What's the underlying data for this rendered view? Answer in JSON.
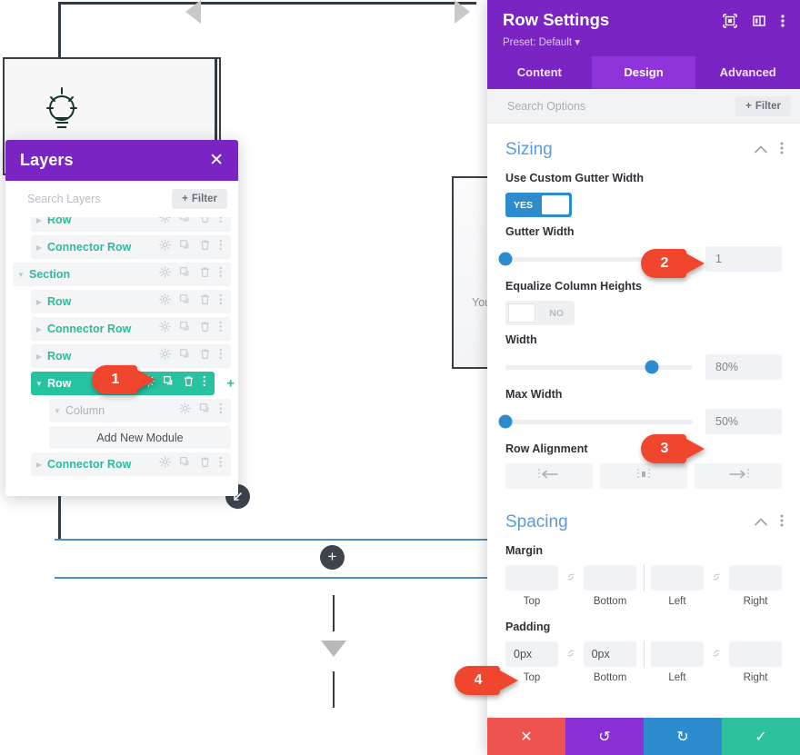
{
  "canvas": {
    "placeholder_text": "You",
    "add_section_icon": "plus-icon",
    "bulb_icon": "lightbulb-icon",
    "resize_icon": "resize-diagonal-icon"
  },
  "layers_panel": {
    "title": "Layers",
    "close_icon": "close-icon",
    "search_placeholder": "Search Layers",
    "filter_label": "Filter",
    "filter_icon": "plus-icon",
    "add_new_module": "Add New Module",
    "row_icons": [
      "gear-icon",
      "duplicate-icon",
      "trash-icon",
      "kebab-icon"
    ],
    "items": [
      {
        "label": "Row",
        "indent": 1,
        "selected": false,
        "clipped": true
      },
      {
        "label": "Connector Row",
        "indent": 1,
        "selected": false
      },
      {
        "label": "Section",
        "indent": 0,
        "selected": false
      },
      {
        "label": "Row",
        "indent": 1,
        "selected": false
      },
      {
        "label": "Connector Row",
        "indent": 1,
        "selected": false
      },
      {
        "label": "Row",
        "indent": 1,
        "selected": false
      },
      {
        "label": "Row",
        "indent": 1,
        "selected": true
      },
      {
        "label": "Column",
        "indent": 2,
        "selected": false,
        "muted": true
      },
      {
        "label": "Connector Row",
        "indent": 1,
        "selected": false
      }
    ]
  },
  "settings_panel": {
    "title": "Row Settings",
    "preset": "Preset: Default",
    "header_icons": [
      "fullscreen-icon",
      "split-view-icon",
      "kebab-icon"
    ],
    "tabs": [
      {
        "label": "Content",
        "active": false
      },
      {
        "label": "Design",
        "active": true
      },
      {
        "label": "Advanced",
        "active": false
      }
    ],
    "search_placeholder": "Search Options",
    "filter_label": "Filter",
    "sections": {
      "sizing": {
        "title": "Sizing",
        "collapse_icon": "chevron-up-icon",
        "menu_icon": "kebab-icon",
        "use_custom_gutter_width": {
          "label": "Use Custom Gutter Width",
          "value": "YES",
          "on": true
        },
        "gutter_width": {
          "label": "Gutter Width",
          "value": "1",
          "slider_pct": 0
        },
        "equalize_column_heights": {
          "label": "Equalize Column Heights",
          "value": "NO",
          "on": false
        },
        "width": {
          "label": "Width",
          "value": "80%",
          "slider_pct": 78
        },
        "max_width": {
          "label": "Max Width",
          "value": "50%",
          "slider_pct": 0
        },
        "row_alignment": {
          "label": "Row Alignment",
          "options": [
            "align-left-icon",
            "align-center-icon",
            "align-right-icon"
          ]
        }
      },
      "spacing": {
        "title": "Spacing",
        "collapse_icon": "chevron-up-icon",
        "menu_icon": "kebab-icon",
        "margin": {
          "label": "Margin",
          "sides": [
            "Top",
            "Bottom",
            "Left",
            "Right"
          ],
          "values": [
            "",
            "",
            "",
            ""
          ]
        },
        "padding": {
          "label": "Padding",
          "sides": [
            "Top",
            "Bottom",
            "Left",
            "Right"
          ],
          "values": [
            "0px",
            "0px",
            "",
            ""
          ]
        }
      }
    },
    "footer": [
      {
        "name": "cancel",
        "icon": "✕",
        "color": "#ef5350"
      },
      {
        "name": "undo",
        "icon": "↺",
        "color": "#8b2fd6"
      },
      {
        "name": "redo",
        "icon": "↻",
        "color": "#2d8ccd"
      },
      {
        "name": "save",
        "icon": "✓",
        "color": "#2cc19c"
      }
    ]
  },
  "callouts": [
    {
      "number": "1",
      "target": "selected-row-gear"
    },
    {
      "number": "2",
      "target": "gutter-width-input"
    },
    {
      "number": "3",
      "target": "max-width-input"
    },
    {
      "number": "4",
      "target": "padding-top-input"
    }
  ],
  "colors": {
    "purple": "#7b24c4",
    "purple_active": "#8f34dd",
    "teal": "#27c2a0",
    "blue": "#2d8ccd",
    "red": "#f0462d",
    "section_title": "#5b9bd5"
  }
}
